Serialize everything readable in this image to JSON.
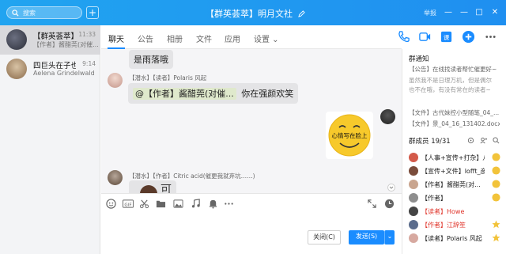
{
  "search": {
    "placeholder": "搜索"
  },
  "window": {
    "title": "【群英荟萃】明月文社",
    "report": "举报"
  },
  "conversations": [
    {
      "name": "【群英荟萃】",
      "time": "11:33",
      "preview": "【作者】酱醋莞(对催..."
    },
    {
      "name": "四巨头在子也",
      "time": "9:14",
      "preview": "Aelena Grindelwald"
    }
  ],
  "tabs": [
    "聊天",
    "公告",
    "相册",
    "文件",
    "应用",
    "设置 ⌄"
  ],
  "messages": {
    "m1_text": "是雨落哦",
    "m2_meta": "【潜水】【读者】Polaris 风起",
    "m2_mention": "@【作者】酱醋莞(对催...",
    "m2_text": "你在强颜欢笑",
    "m3_sticker_text": "心情写在脸上",
    "m4_meta": "【潜水】【作者】Citric acid(催更我就弃坑……)",
    "m4_text": "可"
  },
  "compose": {
    "close_label": "关闭(C)",
    "send_label": "发送(S)"
  },
  "notice": {
    "title": "群通知",
    "line1": "【公告】在线找读者帮忙催更好~",
    "line2": "虽然我不是日理万机，但是偶尔",
    "line3": "也不在哦，有没有常在的读者~",
    "file1": "【文件】古代妹控小型随笔_04_...",
    "file2": "【文件】景_04_16_131402.docx"
  },
  "members": {
    "title": "群成员 19/31",
    "list": [
      {
        "name": "【人事+宣传+打杂】八...",
        "color": "#222"
      },
      {
        "name": "【宣传+文件】lofft_彦...",
        "color": "#222"
      },
      {
        "name": "【作者】酱醋莞(对...",
        "color": "#222"
      },
      {
        "name": "【作者】",
        "color": "#222"
      },
      {
        "name": "【读者】Howe",
        "color": "#e0352b"
      },
      {
        "name": "【作者】江辞笙",
        "color": "#e0352b"
      },
      {
        "name": "【读者】Polaris 风起",
        "color": "#222"
      }
    ]
  },
  "colors": {
    "accent": "#1a8cff",
    "topbar": "#1f9af0",
    "mention_bg": "#dfe9cc"
  }
}
